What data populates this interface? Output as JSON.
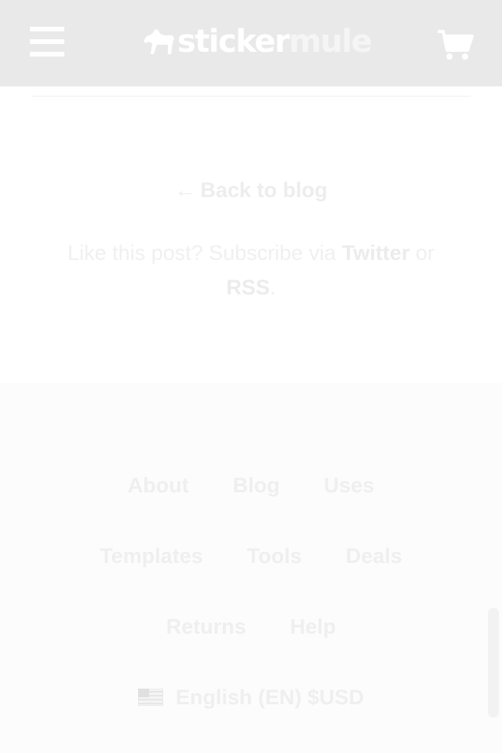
{
  "header": {
    "logo_part1": "sticker",
    "logo_part2": "mule",
    "menu_icon": "hamburger-menu-icon",
    "cart_icon": "shopping-cart-icon",
    "background": "#e9e9e9"
  },
  "post_footer": {
    "back_arrow": "←",
    "back_label": "Back to blog",
    "subscribe_prefix": "Like this post? Subscribe via ",
    "twitter_label": "Twitter",
    "or_label": " or ",
    "rss_label": "RSS",
    "period": "."
  },
  "footer": {
    "row1": [
      "About",
      "Blog",
      "Uses"
    ],
    "row2": [
      "Templates",
      "Tools",
      "Deals"
    ],
    "row3": [
      "Returns",
      "Help"
    ],
    "locale_label": "English (EN) $USD",
    "flag_icon": "us-flag-icon"
  }
}
